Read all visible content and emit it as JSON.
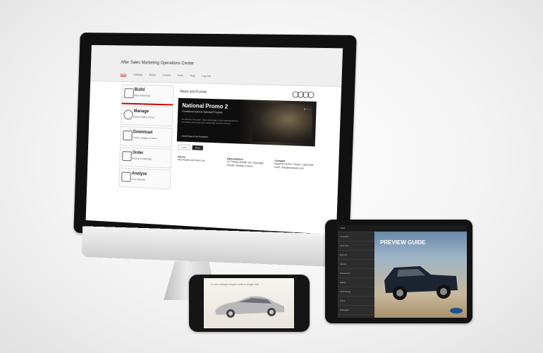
{
  "desktop": {
    "site_title": "After Sales Marketing Operations Center",
    "nav": [
      "Home",
      "Catalogs",
      "Brand",
      "Content",
      "Tools",
      "Help",
      "Log Out"
    ],
    "news_title": "News and Events",
    "sidebar": [
      {
        "label": "Build",
        "sub": "New Marketing",
        "icon": "house-icon"
      },
      {
        "label": "Manage",
        "sub": "Data & Sales Portal",
        "icon": "gears-icon"
      },
      {
        "label": "Download",
        "sub": "Forms, Images & More",
        "icon": "folder-icon"
      },
      {
        "label": "Order",
        "sub": "Assets & Materials",
        "icon": "cart-icon"
      },
      {
        "label": "Analyze",
        "sub": "Your Reports",
        "icon": "bar-chart-icon"
      }
    ],
    "hero": {
      "heading": "National Promo 2",
      "subheading": "Conditional Service Specials Program",
      "body": "Enrollment now open. Take advantage of the national service promotion and boost your dealership service revenue.",
      "link": "› Enroll Now in the Promotion"
    },
    "tabs": [
      "Latest",
      "Most"
    ],
    "columns": [
      {
        "title": "Alerts",
        "text": "New Assets are Now Live"
      },
      {
        "title": "Dates/Notes",
        "text": "Q1 Timing Update. Q2 Campaign Kickoff. Holiday Closure."
      },
      {
        "title": "Contact",
        "text": "Support Center. Phone: 1-800-555-0100. help@example.com"
      }
    ]
  },
  "phone": {
    "caption": "A car's design begins with a single line"
  },
  "tablet": {
    "top_label": "Ford",
    "title": "PREVIEW GUIDE",
    "menu": [
      "Contents",
      "Overview",
      "Exterior",
      "Interior",
      "Powertrain",
      "Safety",
      "Technology",
      "Trims",
      "Packages",
      "Colors"
    ]
  },
  "colors": {
    "accent": "#c00000",
    "background": "#f4f4f4"
  }
}
